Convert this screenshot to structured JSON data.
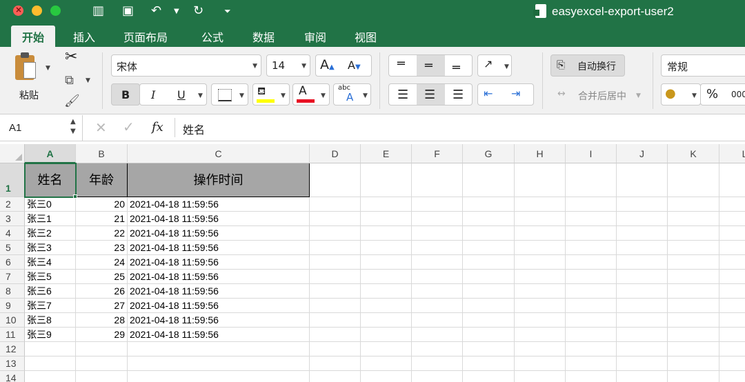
{
  "window": {
    "title": "easyexcel-export-user2"
  },
  "ribbon_tabs": [
    "开始",
    "插入",
    "页面布局",
    "公式",
    "数据",
    "审阅",
    "视图"
  ],
  "toolbar": {
    "paste_label": "粘贴",
    "font_name": "宋体",
    "font_size": "14",
    "bold": "B",
    "italic": "I",
    "underline": "U",
    "wrap_text": "自动换行",
    "merge_center": "合并后居中",
    "number_format": "常规",
    "percent": "%",
    "thousands": "000"
  },
  "formula_bar": {
    "cell_ref": "A1",
    "fx": "fx",
    "content": "姓名"
  },
  "columns": [
    "A",
    "B",
    "C",
    "D",
    "E",
    "F",
    "G",
    "H",
    "I",
    "J",
    "K",
    "L"
  ],
  "row_numbers": [
    "1",
    "2",
    "3",
    "4",
    "5",
    "6",
    "7",
    "8",
    "9",
    "10",
    "11",
    "12",
    "13",
    "14"
  ],
  "sheet": {
    "headers": [
      "姓名",
      "年龄",
      "操作时间"
    ],
    "rows": [
      [
        "张三0",
        "20",
        "2021-04-18 11:59:56"
      ],
      [
        "张三1",
        "21",
        "2021-04-18 11:59:56"
      ],
      [
        "张三2",
        "22",
        "2021-04-18 11:59:56"
      ],
      [
        "张三3",
        "23",
        "2021-04-18 11:59:56"
      ],
      [
        "张三4",
        "24",
        "2021-04-18 11:59:56"
      ],
      [
        "张三5",
        "25",
        "2021-04-18 11:59:56"
      ],
      [
        "张三6",
        "26",
        "2021-04-18 11:59:56"
      ],
      [
        "张三7",
        "27",
        "2021-04-18 11:59:56"
      ],
      [
        "张三8",
        "28",
        "2021-04-18 11:59:56"
      ],
      [
        "张三9",
        "29",
        "2021-04-18 11:59:56"
      ]
    ]
  },
  "colors": {
    "accent": "#217346",
    "header_fill": "#a6a6a6",
    "font_color_bar": "#e81123",
    "highlight_bar": "#ffff00"
  }
}
